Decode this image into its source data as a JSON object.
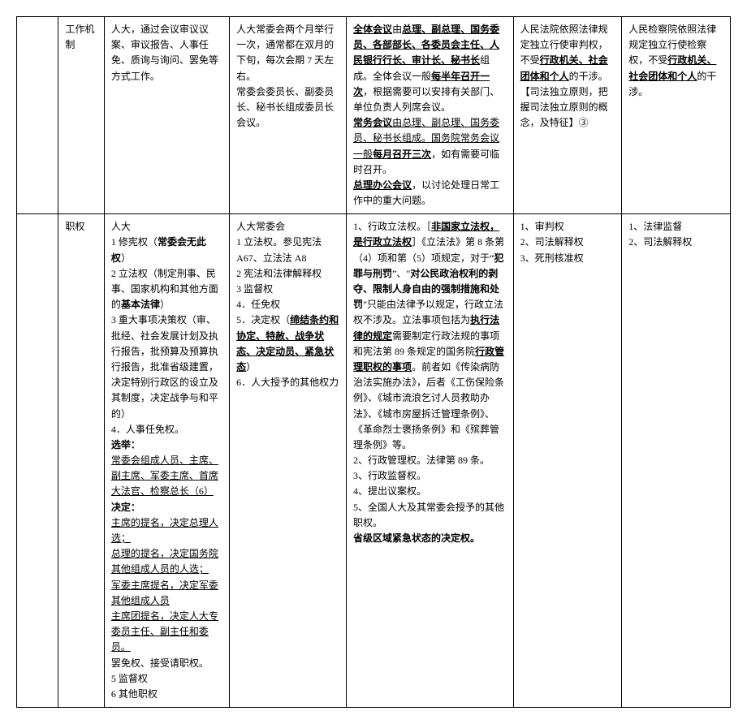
{
  "rows": [
    {
      "label": "工作机制",
      "c2": [
        {
          "t": "人大，通过会议审议议案、审议报告、人事任免、质询与询问、罢免等方式工作。"
        }
      ],
      "c3": [
        {
          "t": "人大常委会两个月举行一次，通常都在双月的下旬，每次会期 7 天左右。"
        },
        {
          "t": "常委会委员长、副委员长、秘书长组成委员长会议。"
        }
      ],
      "c4": [
        {
          "runs": [
            {
              "t": "全体会议",
              "b": true,
              "u": true
            },
            {
              "t": "由"
            },
            {
              "t": "总理、副总理、国务委员、各部部长、各委员会主任、人民银行行长、审计长、秘书长",
              "b": true,
              "u": true
            },
            {
              "t": "组成。全体会议一般"
            },
            {
              "t": "每半年召开一次",
              "b": true,
              "u": true
            },
            {
              "t": "，根据需要可以安排有关部门、单位负责人列席会议。"
            }
          ]
        },
        {
          "runs": [
            {
              "t": "常务会议",
              "b": true,
              "u": true
            },
            {
              "t": "由总理、副总理、国务委员、秘书长组成。国务院常务会议一般",
              "u": true
            },
            {
              "t": "每月召开三次",
              "b": true,
              "u": true
            },
            {
              "t": "，如有需要可临时召开。"
            }
          ]
        },
        {
          "runs": [
            {
              "t": "总理办公会议",
              "b": true,
              "u": true
            },
            {
              "t": "，以讨论处理日常工作中的重大问题。"
            }
          ]
        }
      ],
      "c5": [
        {
          "runs": [
            {
              "t": "人民法院依照法律规定独立行使审判权，不受"
            },
            {
              "t": "行政机关、社会团体和个人",
              "b": true,
              "u": true
            },
            {
              "t": "的干涉。【司法独立原则，把握司法独立原则的概念，及特征】③"
            }
          ]
        }
      ],
      "c6": [
        {
          "runs": [
            {
              "t": "人民检察院依照法律规定独立行使检察权，不受"
            },
            {
              "t": "行政机关、社会团体和个人",
              "b": true,
              "u": true
            },
            {
              "t": "的干涉。"
            }
          ]
        }
      ]
    },
    {
      "label": "职权",
      "c2": [
        {
          "t": "人大"
        },
        {
          "runs": [
            {
              "t": "1 修宪权（"
            },
            {
              "t": "常委会无此权",
              "b": true
            },
            {
              "t": "）"
            }
          ]
        },
        {
          "runs": [
            {
              "t": "2 立法权（制定刑事、民事、国家机构和其他方面的"
            },
            {
              "t": "基本法律",
              "b": true
            },
            {
              "t": "）"
            }
          ]
        },
        {
          "t": "3 重大事项决策权（审、批经、社会发展计划及执行报告，批预算及预算执行报告，批准省级建置，决定特别行政区的设立及其制度，决定战争与和平的）"
        },
        {
          "t": "4．人事任免权。"
        },
        {
          "runs": [
            {
              "t": "选举：",
              "b": true
            }
          ]
        },
        {
          "runs": [
            {
              "t": "常委会组成人员、主席、副主席、军委主席、首席大法官、检察总长（6）",
              "u": true
            }
          ]
        },
        {
          "runs": [
            {
              "t": "决定：",
              "b": true
            }
          ]
        },
        {
          "runs": [
            {
              "t": "主席的提名，决定总理人选；",
              "u": true
            }
          ]
        },
        {
          "runs": [
            {
              "t": "总理的提名，决定国务院其他组成人员的人选；",
              "u": true
            }
          ]
        },
        {
          "runs": [
            {
              "t": "军委主席提名，决定军委其他组成人员",
              "u": true
            }
          ]
        },
        {
          "runs": [
            {
              "t": "主席团提名，决定人大专委员主任、副主任和委员。",
              "u": true
            }
          ]
        },
        {
          "t": "罢免权、接受请职权。"
        },
        {
          "t": "5 监督权"
        },
        {
          "t": "6 其他职权"
        }
      ],
      "c3": [
        {
          "t": "人大常委会"
        },
        {
          "t": "1 立法权。参见宪法 A67、立法法 A8"
        },
        {
          "t": "2 宪法和法律解释权"
        },
        {
          "t": "3 监督权"
        },
        {
          "t": "4．任免权"
        },
        {
          "runs": [
            {
              "t": "5．决定权（"
            },
            {
              "t": "缔结条约和协定、特赦、战争状态、决定动员、紧急状态",
              "b": true,
              "u": true
            },
            {
              "t": "）"
            }
          ]
        },
        {
          "t": "6．人大授予的其他权力"
        }
      ],
      "c4": [
        {
          "runs": [
            {
              "t": "1、行政立法权。［"
            },
            {
              "t": "非国家立法权，是行政立法权",
              "b": true,
              "u": true
            },
            {
              "t": "］《立法法》第 8 条第（4）项和第（5）项规定，对于“"
            },
            {
              "t": "犯罪与刑罚",
              "b": true
            },
            {
              "t": "”、\""
            },
            {
              "t": "对公民政治权利的剥夺、限制人身自由的强制措施和处罚",
              "b": true
            },
            {
              "t": "\"只能由法律予以规定，行政立法权不涉及。立法事项包括为"
            },
            {
              "t": "执行法律的规定",
              "b": true,
              "u": true
            },
            {
              "t": "需要制定行政法规的事项和宪法第 89 条规定的国务院"
            },
            {
              "t": "行政管理职权的事项",
              "b": true,
              "u": true
            },
            {
              "t": "。前者如《传染病防治法实施办法》，后者《工伤保险条例》、《城市流浪乞讨人员救助办法》、《城市房屋拆迁管理条例》、《革命烈士褒扬条例》和《殡葬管理条例》等。"
            }
          ]
        },
        {
          "t": "2、行政管理权。法律第 89 条。"
        },
        {
          "t": "3、行政监督权。"
        },
        {
          "t": "4、提出议案权。"
        },
        {
          "t": "5、全国人大及其常委会授予的其他职权。"
        },
        {
          "runs": [
            {
              "t": "省级区域紧急状态的决定权。",
              "b": true
            }
          ]
        }
      ],
      "c5": [
        {
          "t": "1、审判权"
        },
        {
          "t": "2、司法解释权"
        },
        {
          "t": "3、死刑核准权"
        }
      ],
      "c6": [
        {
          "t": "1、法律监督"
        },
        {
          "t": "2、司法解释权"
        }
      ]
    }
  ]
}
